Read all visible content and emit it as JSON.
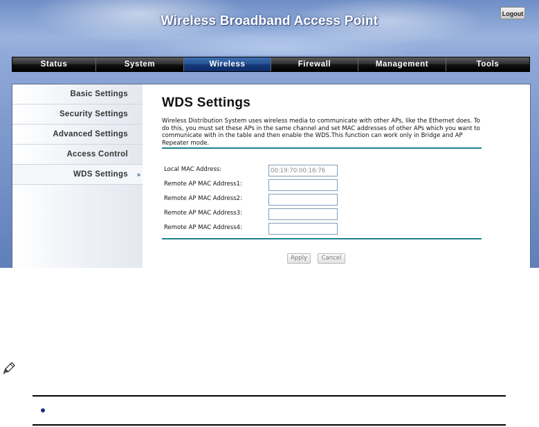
{
  "header": {
    "title": "Wireless Broadband Access Point",
    "logout_label": "Logout"
  },
  "nav": {
    "tabs": [
      {
        "label": "Status"
      },
      {
        "label": "System"
      },
      {
        "label": "Wireless",
        "active": true
      },
      {
        "label": "Firewall"
      },
      {
        "label": "Management"
      },
      {
        "label": "Tools"
      }
    ]
  },
  "sidebar": {
    "items": [
      {
        "label": "Basic Settings"
      },
      {
        "label": "Security Settings"
      },
      {
        "label": "Advanced Settings"
      },
      {
        "label": "Access Control"
      },
      {
        "label": "WDS Settings",
        "active": true
      }
    ],
    "active_arrow": "»"
  },
  "main": {
    "title": "WDS Settings",
    "description": "Wireless Distribution System uses wireless media to communicate with other APs, like the Ethernet does. To do this, you must set these APs in the same channel and set MAC addresses of other APs which you want to communicate with in the table and then enable the WDS.This function can work only in Bridge and AP Repeater mode.",
    "fields": [
      {
        "label": "Local MAC Address:",
        "value": "00:19:70:00:16:76",
        "readonly": true
      },
      {
        "label": "Remote AP MAC Address1:",
        "value": ""
      },
      {
        "label": "Remote AP MAC Address2:",
        "value": ""
      },
      {
        "label": "Remote AP MAC Address3:",
        "value": ""
      },
      {
        "label": "Remote AP MAC Address4:",
        "value": ""
      }
    ],
    "apply_label": "Apply",
    "cancel_label": "Cancel"
  },
  "colors": {
    "nav_active": "#1f4f8f",
    "rule": "#1f7f8f",
    "bullet": "#1a2f8a"
  },
  "icons": {
    "note": "pencil-icon",
    "bullet": "bullet-dot-icon"
  }
}
